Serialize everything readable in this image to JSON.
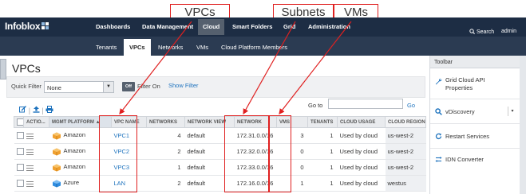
{
  "app": {
    "name": "Infoblox"
  },
  "header": {
    "nav": [
      "Dashboards",
      "Data Management",
      "Cloud",
      "Smart Folders",
      "Grid",
      "Administration"
    ],
    "active": "Cloud",
    "search_label": "Search",
    "user": "admin"
  },
  "subnav": {
    "items": [
      "Tenants",
      "VPCs",
      "Networks",
      "VMs",
      "Cloud Platform Members"
    ],
    "active": "VPCs"
  },
  "page": {
    "title": "VPCs"
  },
  "filter": {
    "quick_filter_label": "Quick Filter",
    "quick_filter_value": "None",
    "toggle_label": "Off",
    "filter_on_label": "Filter On",
    "show_filter_label": "Show Filter"
  },
  "goto": {
    "label": "Go to",
    "value": "",
    "button": "Go"
  },
  "table": {
    "columns": [
      "ACTIO...",
      "MGMT PLATFORM",
      "VPC NAME",
      "NETWORKS",
      "NETWORK VIEW",
      "NETWORK",
      "VMS",
      "TENANTS",
      "CLOUD USAGE",
      "CLOUD REGION"
    ],
    "rows": [
      {
        "platform": "Amazon",
        "vpc_name": "VPC1",
        "networks": "4",
        "network_view": "default",
        "network": "172.31.0.0/16",
        "vms": "3",
        "tenants": "1",
        "cloud_usage": "Used by cloud",
        "cloud_region": "us-west-2"
      },
      {
        "platform": "Amazon",
        "vpc_name": "VPC2",
        "networks": "2",
        "network_view": "default",
        "network": "172.32.0.0/16",
        "vms": "0",
        "tenants": "1",
        "cloud_usage": "Used by cloud",
        "cloud_region": "us-west-2"
      },
      {
        "platform": "Amazon",
        "vpc_name": "VPC3",
        "networks": "1",
        "network_view": "default",
        "network": "172.33.0.0/16",
        "vms": "0",
        "tenants": "1",
        "cloud_usage": "Used by cloud",
        "cloud_region": "us-west-2"
      },
      {
        "platform": "Azure",
        "vpc_name": "LAN",
        "networks": "2",
        "network_view": "default",
        "network": "172.16.0.0/16",
        "vms": "1",
        "tenants": "1",
        "cloud_usage": "Used by cloud",
        "cloud_region": "westus"
      }
    ]
  },
  "toolbar": {
    "title": "Toolbar",
    "items": [
      {
        "label_line1": "Grid Cloud API",
        "label_line2": "Properties"
      },
      {
        "label_line1": "vDiscovery",
        "label_line2": ""
      },
      {
        "label_line1": "Restart Services",
        "label_line2": ""
      },
      {
        "label_line1": "IDN Converter",
        "label_line2": ""
      }
    ]
  },
  "annotations": {
    "vpcs": "VPCs",
    "subnets": "Subnets",
    "vms": "VMs"
  },
  "colors": {
    "header_bg": "#1d2d44",
    "subnav_bg": "#2b3b52",
    "link": "#1e73be",
    "annotation": "#e02020"
  }
}
